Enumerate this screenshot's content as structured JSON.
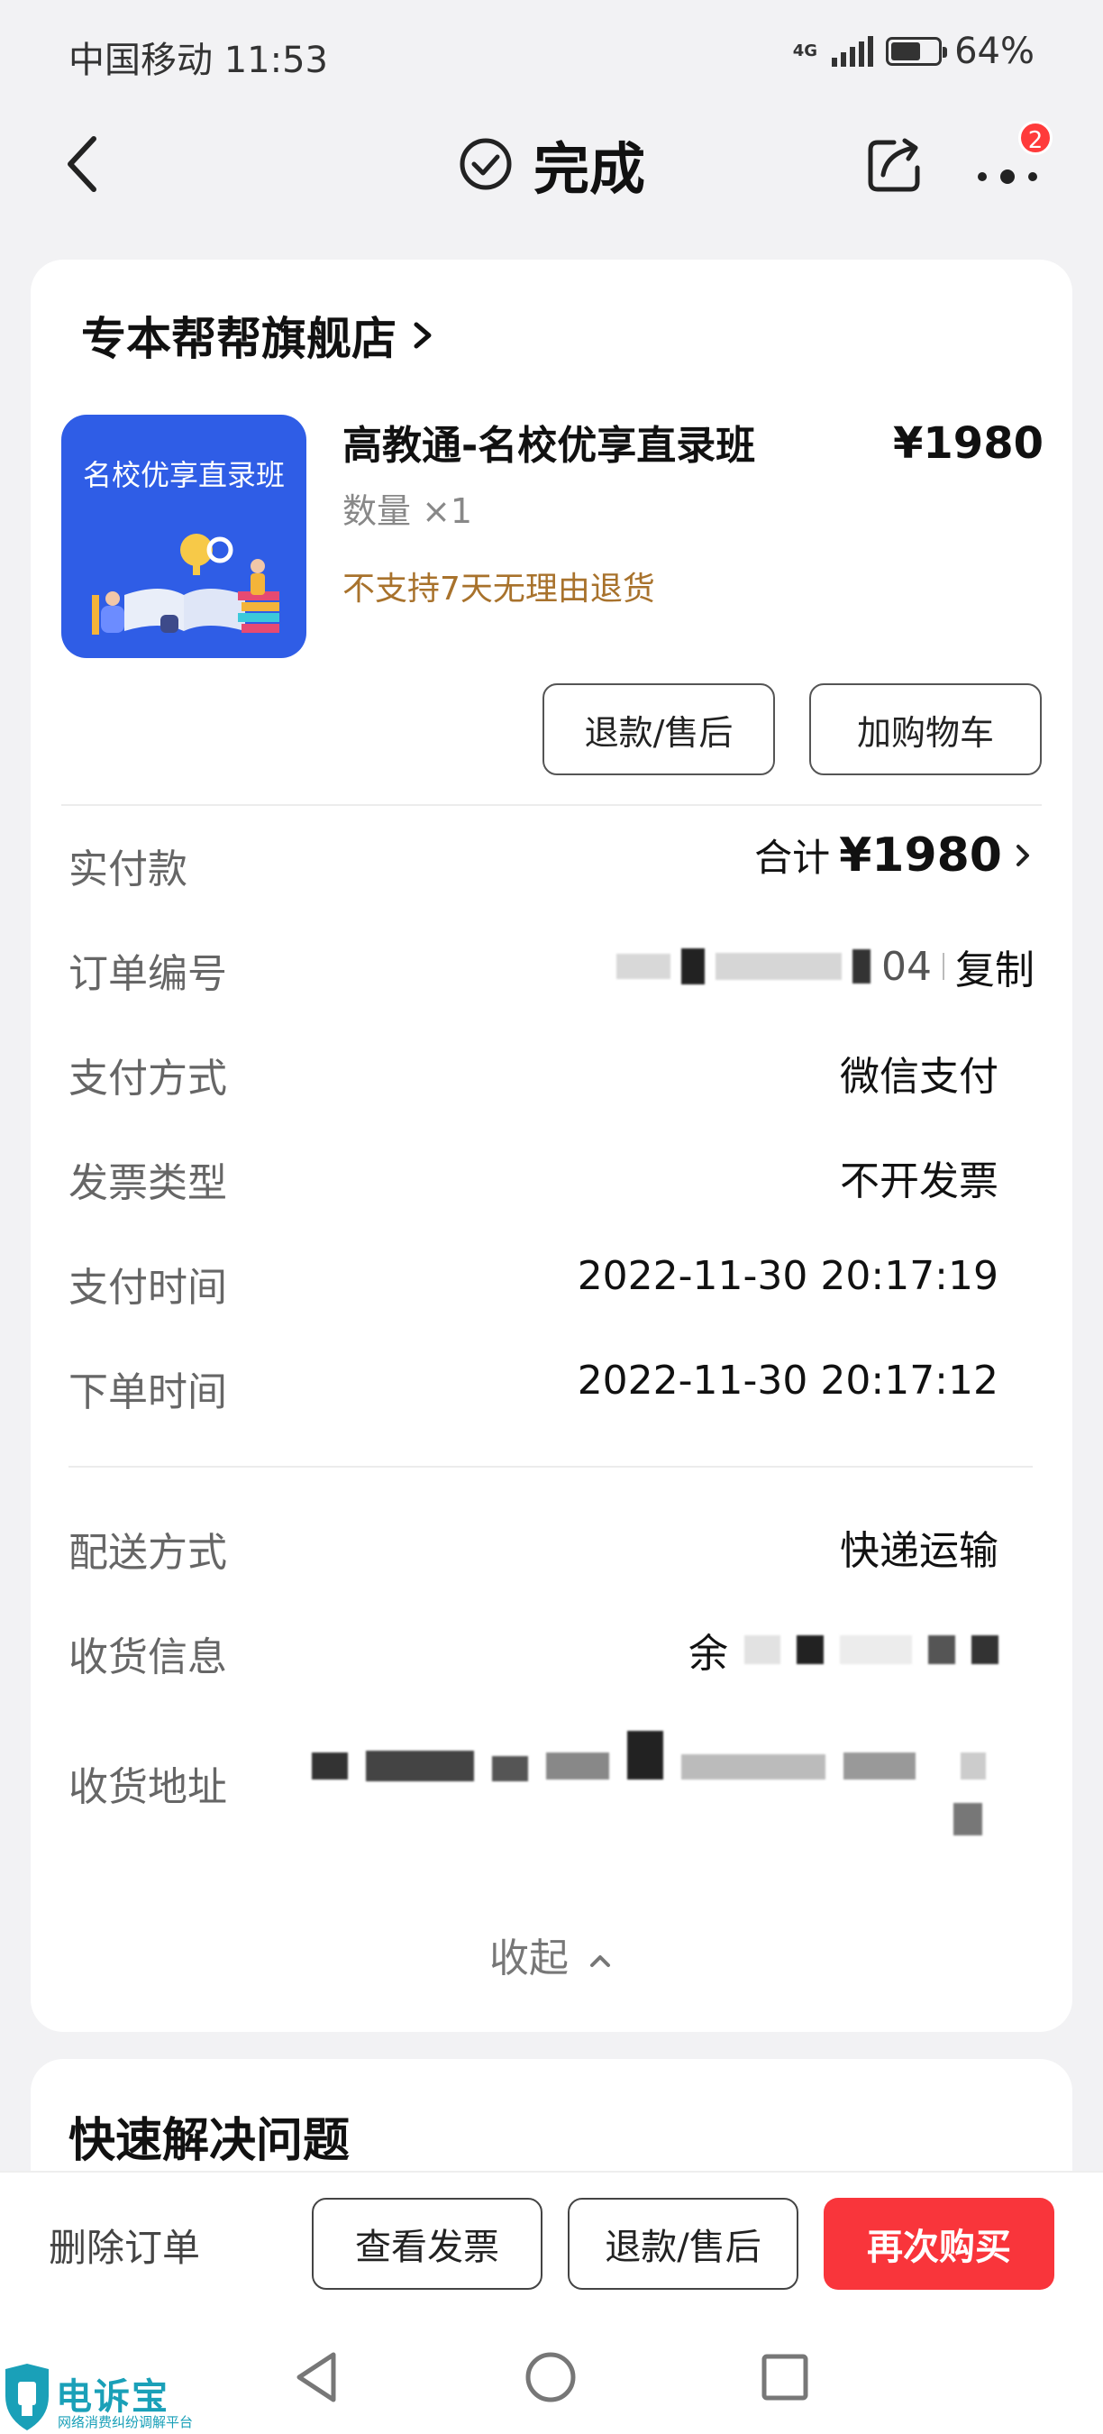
{
  "status_bar": {
    "carrier_time": "中国移动 11:53",
    "network": "4G",
    "battery_percent": "64%",
    "battery_level": 0.64
  },
  "nav": {
    "title": "完成",
    "notification_count": "2"
  },
  "order": {
    "store_name": "专本帮帮旗舰店",
    "product": {
      "thumb_text": "名校优享直录班",
      "title": "高教通-名校优享直录班",
      "price": "¥1980",
      "quantity": "数量 ×1",
      "return_policy": "不支持7天无理由退货"
    },
    "buttons": {
      "refund": "退款/售后",
      "add_cart": "加购物车"
    },
    "details": [
      {
        "label": "实付款",
        "value_prefix": "合计",
        "value": "¥1980"
      },
      {
        "label": "订单编号",
        "value": "04",
        "copy": "复制"
      },
      {
        "label": "支付方式",
        "value": "微信支付"
      },
      {
        "label": "发票类型",
        "value": "不开发票"
      },
      {
        "label": "支付时间",
        "value": "2022-11-30 20:17:19"
      },
      {
        "label": "下单时间",
        "value": "2022-11-30 20:17:12"
      }
    ],
    "shipping": [
      {
        "label": "配送方式",
        "value": "快递运输"
      },
      {
        "label": "收货信息",
        "value": "余"
      },
      {
        "label": "收货地址",
        "value": ""
      }
    ],
    "collapse_label": "收起"
  },
  "quick_help": {
    "title": "快速解决问题"
  },
  "action_bar": {
    "delete": "删除订单",
    "view_invoice": "查看发票",
    "refund": "退款/售后",
    "buy_again": "再次购买"
  },
  "watermark": {
    "name": "电诉宝",
    "subtitle": "网络消费纠纷调解平台"
  },
  "colors": {
    "accent_red": "#ff3b3b",
    "return_policy": "#a8722c",
    "thumb_blue": "#2f5de6"
  }
}
